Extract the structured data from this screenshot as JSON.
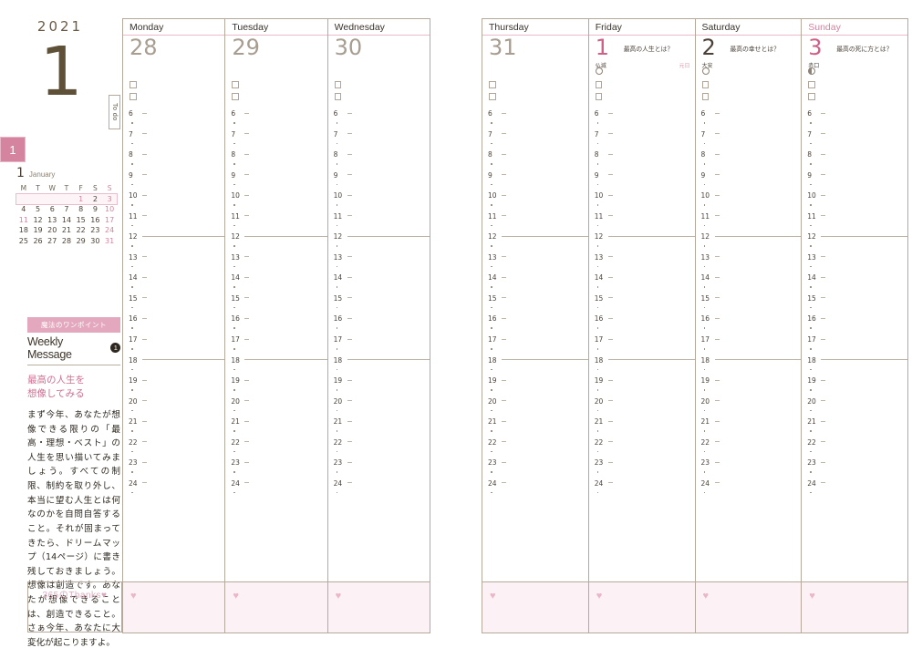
{
  "masthead": {
    "year": "2021",
    "month_big": "1"
  },
  "month_tab": {
    "label": "1"
  },
  "mini_calendar": {
    "month_num": "1",
    "month_name": "January",
    "dow": [
      "M",
      "T",
      "W",
      "T",
      "F",
      "S",
      "S"
    ],
    "weeks": [
      [
        "",
        "",
        "",
        "",
        "1",
        "2",
        "3"
      ],
      [
        "4",
        "5",
        "6",
        "7",
        "8",
        "9",
        "10"
      ],
      [
        "11",
        "12",
        "13",
        "14",
        "15",
        "16",
        "17"
      ],
      [
        "18",
        "19",
        "20",
        "21",
        "22",
        "23",
        "24"
      ],
      [
        "25",
        "26",
        "27",
        "28",
        "29",
        "30",
        "31"
      ]
    ],
    "highlight_week_index": 0,
    "pink_days": [
      "1",
      "3",
      "10",
      "11",
      "17",
      "24",
      "31"
    ]
  },
  "weekly_message": {
    "ribbon": "魔法のワンポイント",
    "title": "Weekly Message",
    "badge": "1",
    "subtitle": "最高の人生を\n想像してみる",
    "body": "まず今年、あなたが想像できる限りの「最高・理想・ベスト」の人生を思い描いてみましょう。すべての制限、制約を取り外し、本当に望む人生とは何なのかを自問自答すること。それが固まってきたら、ドリームマップ（14ページ）に書き残しておきましょう。想像は創造です。あなたが想像できることは、創造できること。さぁ今年、あなたに大変化が起こりますよ。"
  },
  "thanks": {
    "label": "365のThanks",
    "heart": "♥"
  },
  "todo_tab": {
    "label": "To do"
  },
  "timeline": {
    "hours": [
      "6",
      "7",
      "8",
      "9",
      "10",
      "11",
      "12",
      "13",
      "14",
      "15",
      "16",
      "17",
      "18",
      "19",
      "20",
      "21",
      "22",
      "23",
      "24"
    ],
    "major_hours": [
      "12",
      "18"
    ]
  },
  "days": [
    {
      "dow": "Monday",
      "date": "28",
      "date_style": "prev",
      "note": "",
      "rokuyo": "",
      "holiday": "",
      "moon": "none",
      "checkboxes": 2
    },
    {
      "dow": "Tuesday",
      "date": "29",
      "date_style": "prev",
      "note": "",
      "rokuyo": "",
      "holiday": "",
      "moon": "none",
      "checkboxes": 2
    },
    {
      "dow": "Wednesday",
      "date": "30",
      "date_style": "prev",
      "note": "",
      "rokuyo": "",
      "holiday": "",
      "moon": "none",
      "checkboxes": 2
    },
    {
      "dow": "Thursday",
      "date": "31",
      "date_style": "prev",
      "note": "",
      "rokuyo": "",
      "holiday": "",
      "moon": "none",
      "checkboxes": 2
    },
    {
      "dow": "Friday",
      "date": "1",
      "date_style": "pink",
      "note": "最高の人生とは？",
      "rokuyo": "仏滅",
      "holiday": "元日",
      "moon": "open",
      "checkboxes": 2
    },
    {
      "dow": "Saturday",
      "date": "2",
      "date_style": "current",
      "note": "最高の幸せとは？",
      "rokuyo": "大安",
      "holiday": "",
      "moon": "open",
      "checkboxes": 2
    },
    {
      "dow": "Sunday",
      "date": "3",
      "date_style": "pink",
      "note": "最高の死に方とは？",
      "rokuyo": "赤口",
      "holiday": "",
      "moon": "half",
      "checkboxes": 2
    }
  ]
}
